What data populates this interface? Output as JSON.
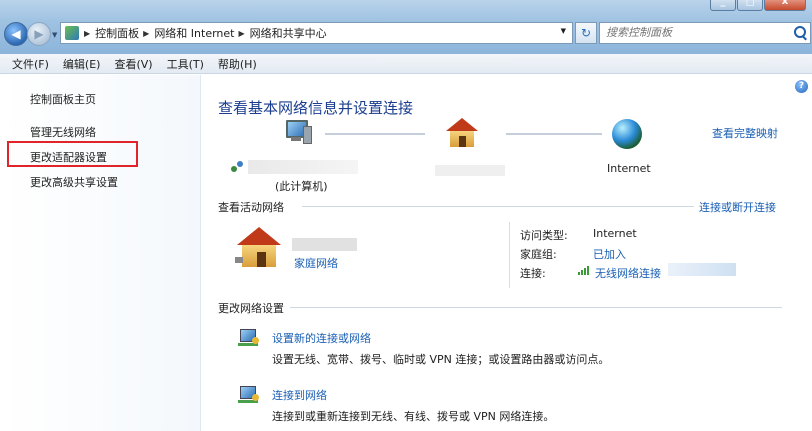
{
  "window": {
    "controls": {
      "minimize": "minimize-icon",
      "maximize": "maximize-icon",
      "close": "close-icon"
    }
  },
  "address": {
    "icon": "control-panel-icon",
    "breadcrumbs": [
      "控制面板",
      "网络和 Internet",
      "网络和共享中心"
    ],
    "separator": "▶"
  },
  "search": {
    "placeholder": "搜索控制面板"
  },
  "menu": [
    "文件(F)",
    "编辑(E)",
    "查看(V)",
    "工具(T)",
    "帮助(H)"
  ],
  "sidebar": {
    "items": [
      "控制面板主页",
      "管理无线网络",
      "更改适配器设置",
      "更改高级共享设置"
    ],
    "highlighted_index": 2,
    "highlight_color": "#e0242a"
  },
  "main": {
    "title": "查看基本网络信息并设置连接",
    "view_full_map": "查看完整映射",
    "this_computer": "(此计算机)",
    "internet": "Internet",
    "active_networks": {
      "heading": "查看活动网络",
      "connect_disconnect": "连接或断开连接",
      "network_type": "家庭网络",
      "rows": [
        {
          "label": "访问类型:",
          "value": "Internet",
          "is_link": false
        },
        {
          "label": "家庭组:",
          "value": "已加入",
          "is_link": true
        },
        {
          "label": "连接:",
          "value": "无线网络连接",
          "is_link": true
        }
      ]
    },
    "change_settings": {
      "heading": "更改网络设置",
      "tasks": [
        {
          "title": "设置新的连接或网络",
          "desc": "设置无线、宽带、拨号、临时或 VPN 连接；或设置路由器或访问点。"
        },
        {
          "title": "连接到网络",
          "desc": "连接到或重新连接到无线、有线、拨号或 VPN 网络连接。"
        }
      ]
    }
  },
  "colors": {
    "link": "#1a5fb4",
    "title": "#1a3d8f",
    "titlebar": "#9fc2e2"
  }
}
